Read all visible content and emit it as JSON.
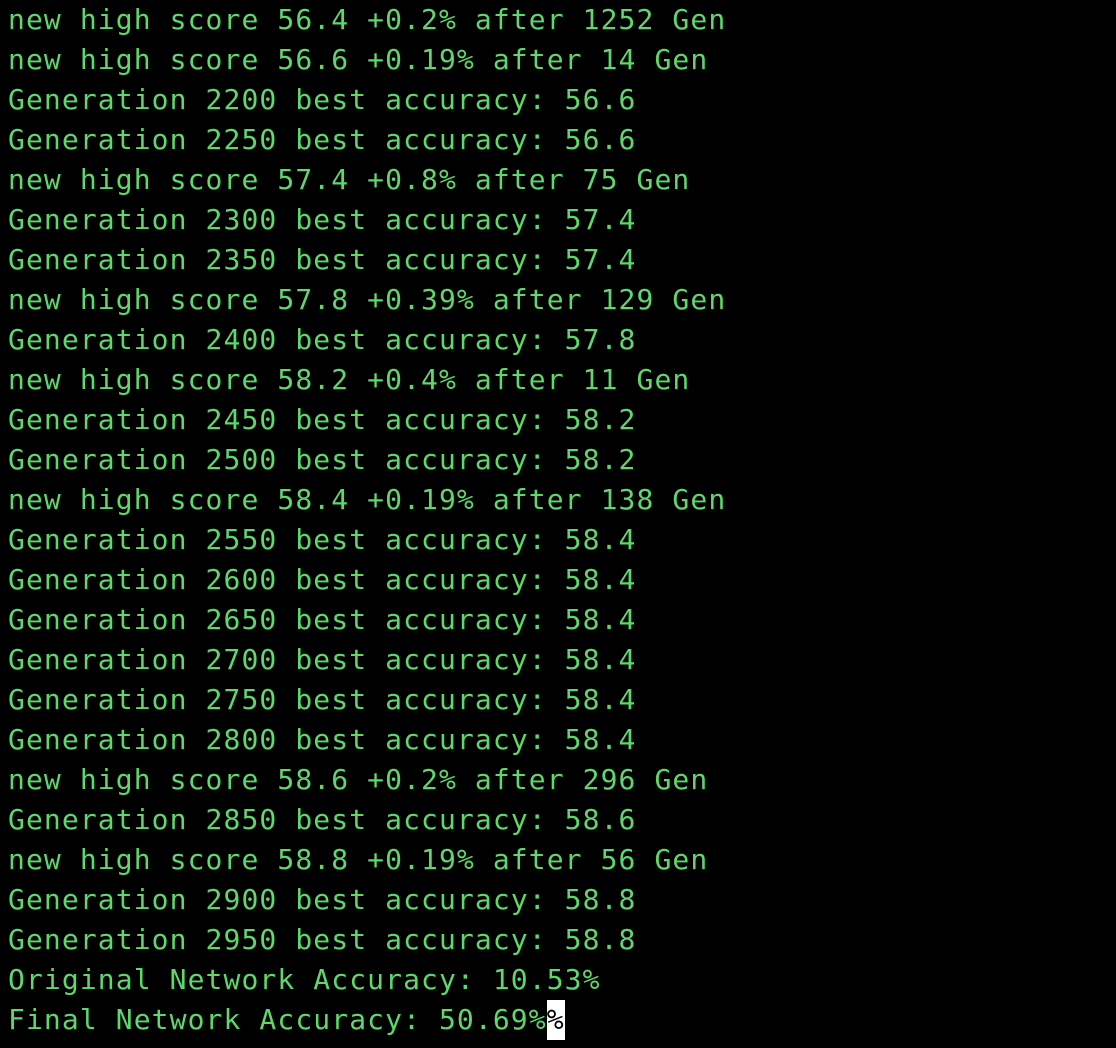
{
  "terminal": {
    "text_color": "#5dd86a",
    "background": "#000000",
    "lines": [
      "new high score 56.4 +0.2% after 1252 Gen",
      "new high score 56.6 +0.19% after 14 Gen",
      "Generation 2200 best accuracy: 56.6",
      "Generation 2250 best accuracy: 56.6",
      "new high score 57.4 +0.8% after 75 Gen",
      "Generation 2300 best accuracy: 57.4",
      "Generation 2350 best accuracy: 57.4",
      "new high score 57.8 +0.39% after 129 Gen",
      "Generation 2400 best accuracy: 57.8",
      "new high score 58.2 +0.4% after 11 Gen",
      "Generation 2450 best accuracy: 58.2",
      "Generation 2500 best accuracy: 58.2",
      "new high score 58.4 +0.19% after 138 Gen",
      "Generation 2550 best accuracy: 58.4",
      "Generation 2600 best accuracy: 58.4",
      "Generation 2650 best accuracy: 58.4",
      "Generation 2700 best accuracy: 58.4",
      "Generation 2750 best accuracy: 58.4",
      "Generation 2800 best accuracy: 58.4",
      "new high score 58.6 +0.2% after 296 Gen",
      "Generation 2850 best accuracy: 58.6",
      "new high score 58.8 +0.19% after 56 Gen",
      "Generation 2900 best accuracy: 58.8",
      "Generation 2950 best accuracy: 58.8",
      "Original Network Accuracy: 10.53%",
      "Final Network Accuracy: 50.69%"
    ],
    "cursor_glyph": "%"
  }
}
